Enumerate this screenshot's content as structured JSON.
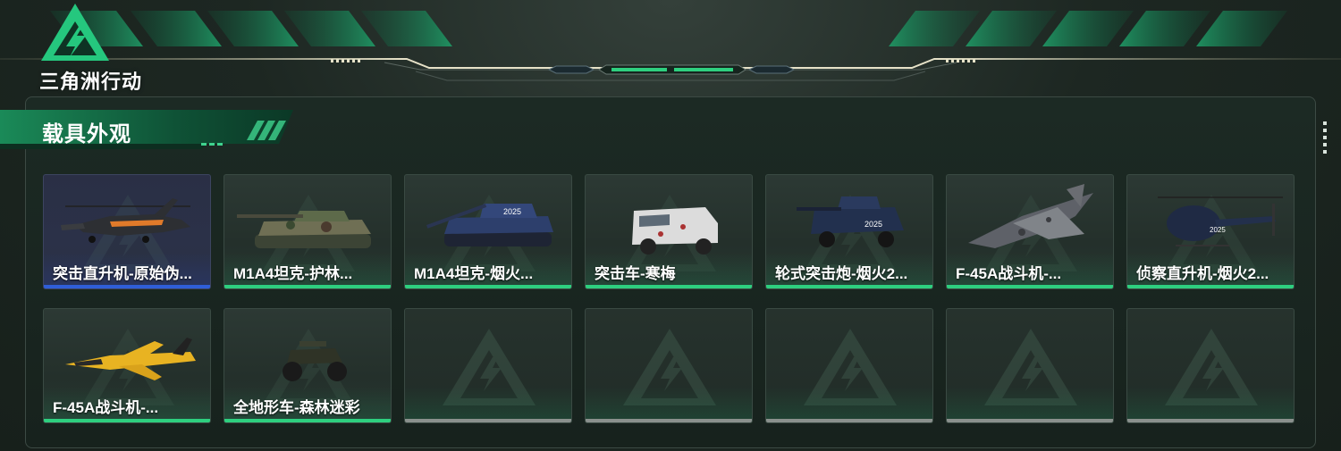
{
  "app": {
    "logo_text": "三角洲行动"
  },
  "section": {
    "title": "载具外观"
  },
  "colors": {
    "accent_green": "#2ecf7f",
    "selected_blue": "#2f5ed8",
    "empty_gray": "#8a908d"
  },
  "items": [
    {
      "label": "突击直升机-原始伪...",
      "icon": "attack-helicopter",
      "state": "selected"
    },
    {
      "label": "M1A4坦克-护林...",
      "icon": "tank-woodland",
      "state": "owned"
    },
    {
      "label": "M1A4坦克-烟火...",
      "icon": "tank-blue",
      "state": "owned"
    },
    {
      "label": "突击车-寒梅",
      "icon": "assault-vehicle-white",
      "state": "owned"
    },
    {
      "label": "轮式突击炮-烟火2...",
      "icon": "wheeled-assault-gun",
      "state": "owned"
    },
    {
      "label": "F-45A战斗机-...",
      "icon": "fighter-jet-camo",
      "state": "owned"
    },
    {
      "label": "侦察直升机-烟火2...",
      "icon": "recon-helicopter",
      "state": "owned"
    },
    {
      "label": "F-45A战斗机-...",
      "icon": "fighter-jet-yellow",
      "state": "owned"
    },
    {
      "label": "全地形车-森林迷彩",
      "icon": "atv",
      "state": "owned"
    },
    {
      "label": "",
      "icon": "",
      "state": "empty"
    },
    {
      "label": "",
      "icon": "",
      "state": "empty"
    },
    {
      "label": "",
      "icon": "",
      "state": "empty"
    },
    {
      "label": "",
      "icon": "",
      "state": "empty"
    },
    {
      "label": "",
      "icon": "",
      "state": "empty"
    }
  ]
}
